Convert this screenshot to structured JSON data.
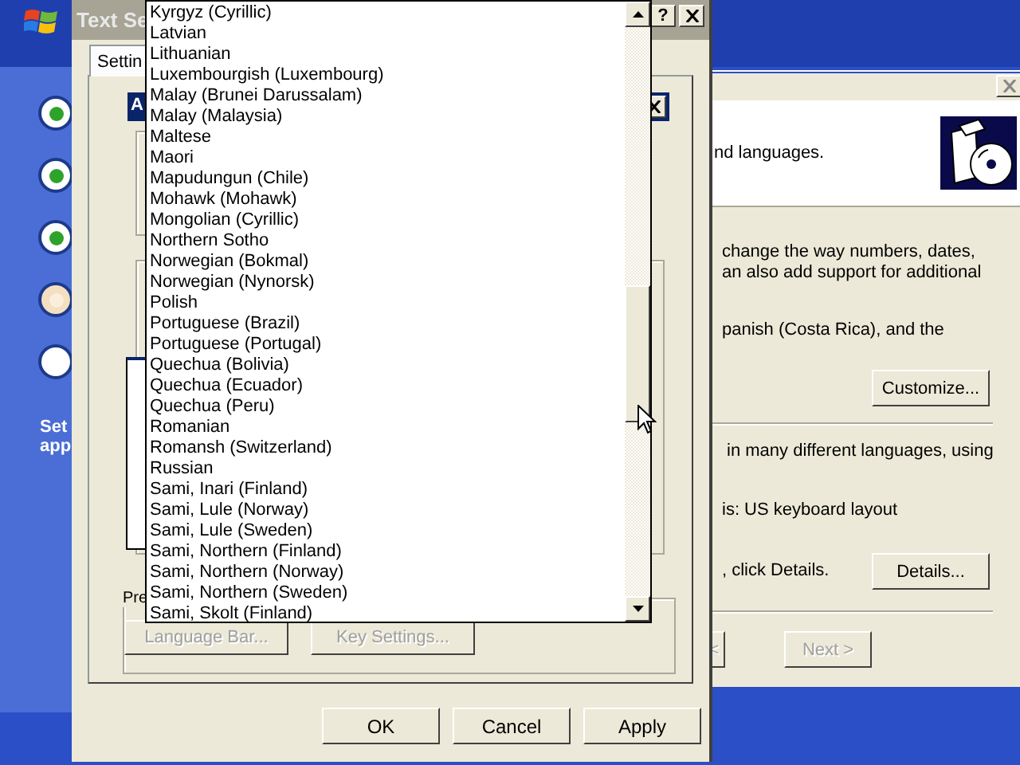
{
  "setup_panel": {
    "steps": [
      {
        "kind": "done"
      },
      {
        "kind": "done"
      },
      {
        "kind": "done"
      },
      {
        "kind": "current"
      },
      {
        "kind": "pending"
      }
    ],
    "caption": [
      "Set",
      "app"
    ]
  },
  "regional_window": {
    "header_text": "nd languages.",
    "section_1": [
      "change the way numbers, dates,",
      "an also add support for additional",
      "panish (Costa Rica), and the"
    ],
    "customize_button": "Customize...",
    "section_2": [
      "in many different languages, using",
      "is: US keyboard layout",
      ", click Details."
    ],
    "details_button": "Details...",
    "back_button": {
      "label": "<",
      "disabled": true
    },
    "next_button": {
      "label": "Next >",
      "disabled": true
    }
  },
  "text_services": {
    "title": "Text Se",
    "help_button": "?",
    "tab": "Settin",
    "add_dialog_title": "A",
    "preferences_label": "Pre",
    "language_bar_button": {
      "label": "Language Bar...",
      "disabled": true
    },
    "key_settings_button": {
      "label": "Key Settings...",
      "disabled": true
    },
    "buttons": [
      "OK",
      "Cancel",
      "Apply"
    ]
  },
  "dropdown": {
    "items": [
      "Kyrgyz (Cyrillic)",
      "Latvian",
      "Lithuanian",
      "Luxembourgish (Luxembourg)",
      "Malay (Brunei Darussalam)",
      "Malay (Malaysia)",
      "Maltese",
      "Maori",
      "Mapudungun (Chile)",
      "Mohawk (Mohawk)",
      "Mongolian (Cyrillic)",
      "Northern Sotho",
      "Norwegian (Bokmal)",
      "Norwegian (Nynorsk)",
      "Polish",
      "Portuguese (Brazil)",
      "Portuguese (Portugal)",
      "Quechua (Bolivia)",
      "Quechua (Ecuador)",
      "Quechua (Peru)",
      "Romanian",
      "Romansh (Switzerland)",
      "Russian",
      "Sami, Inari (Finland)",
      "Sami, Lule (Norway)",
      "Sami, Lule (Sweden)",
      "Sami, Northern (Finland)",
      "Sami, Northern (Norway)",
      "Sami, Northern (Sweden)",
      "Sami, Skolt (Finland)"
    ]
  }
}
